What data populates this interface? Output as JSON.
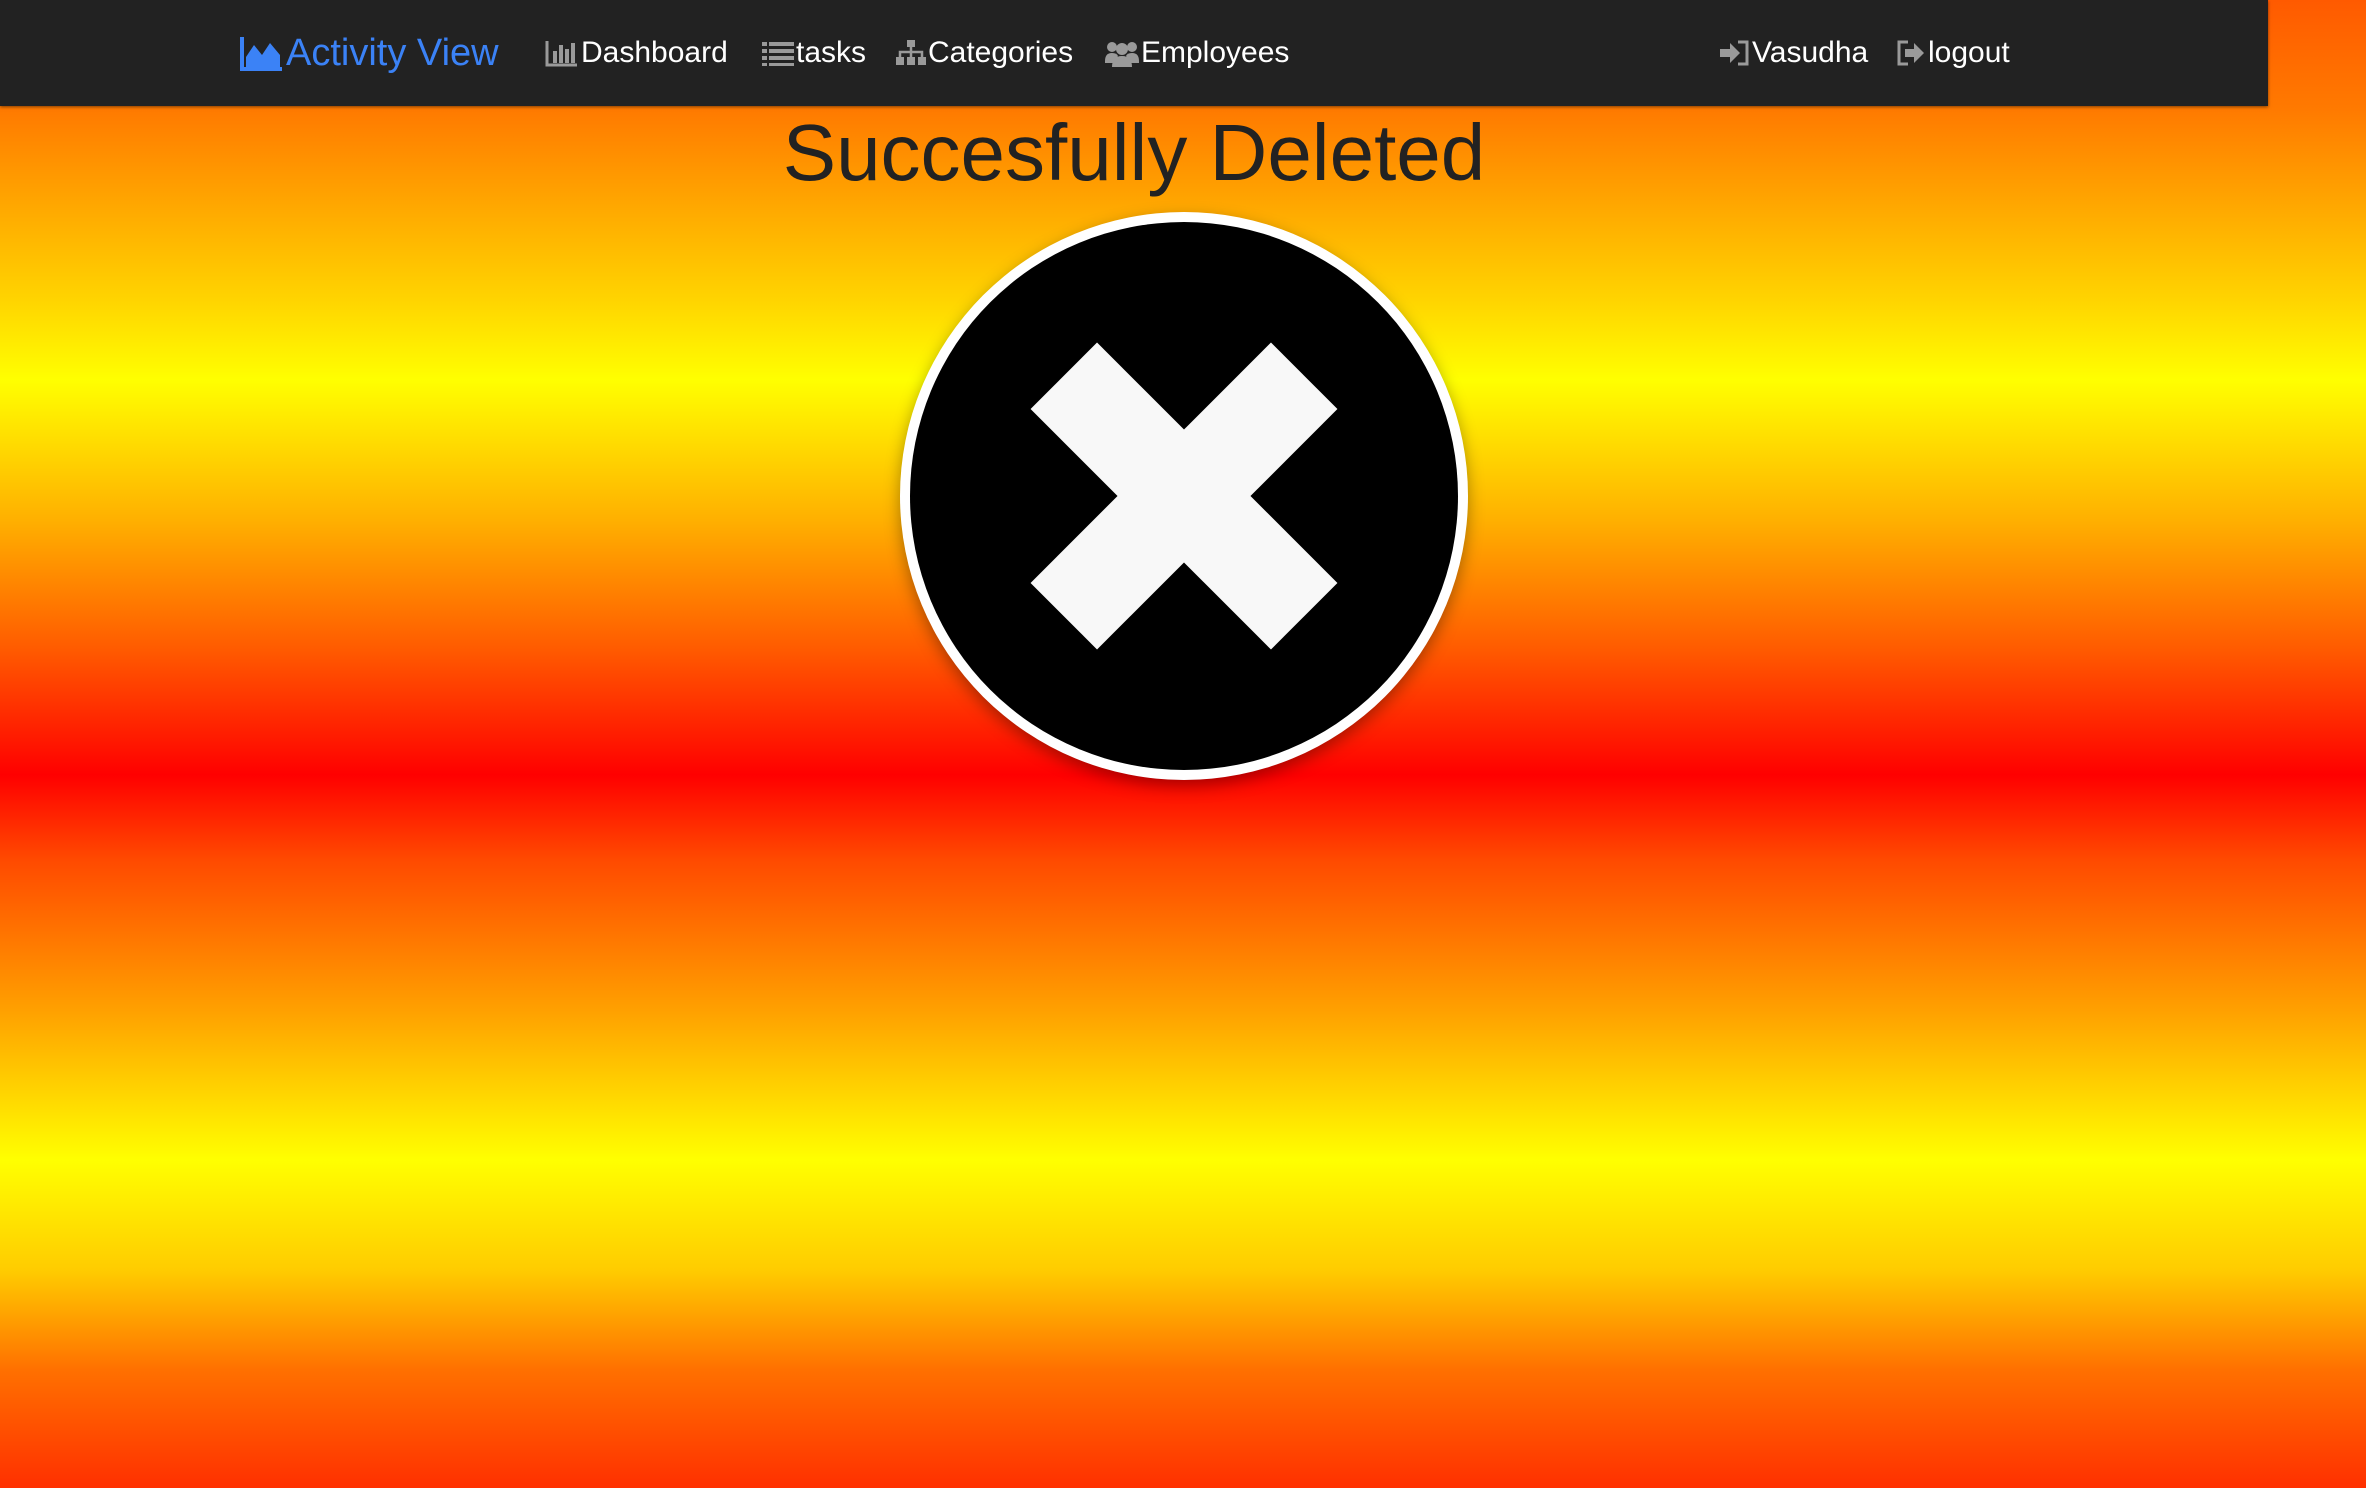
{
  "navbar": {
    "brand": {
      "label": "Activity View",
      "icon": "area-chart-icon",
      "color": "#3b82f6"
    },
    "items": [
      {
        "label": "Dashboard",
        "icon": "bar-chart-icon"
      },
      {
        "label": "tasks",
        "icon": "list-icon"
      },
      {
        "label": "Categories",
        "icon": "sitemap-icon"
      },
      {
        "label": "Employees",
        "icon": "users-icon"
      }
    ],
    "right": [
      {
        "label": "Vasudha",
        "icon": "sign-in-icon"
      },
      {
        "label": "logout",
        "icon": "sign-out-icon"
      }
    ],
    "background": "#222222"
  },
  "main": {
    "title": "Succesfully Deleted",
    "status_icon": "delete-x-icon"
  }
}
